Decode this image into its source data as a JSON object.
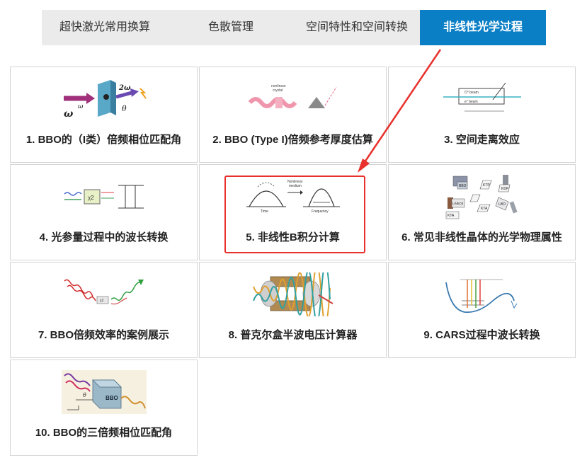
{
  "tabs": [
    {
      "label": "超快激光常用换算"
    },
    {
      "label": "色散管理"
    },
    {
      "label": "空间特性和空间转换"
    },
    {
      "label": "非线性光学过程",
      "active": true
    }
  ],
  "colors": {
    "accent": "#0b7fc6",
    "highlight": "#e8302c",
    "tab_bg": "#ebebeb"
  },
  "cards": [
    {
      "label": "1. BBO的（I类）倍频相位匹配角",
      "icon": "bbo-shg-crystal-icon",
      "art_text": [
        "ω",
        "ω",
        "2ω",
        "θ"
      ]
    },
    {
      "label": "2. BBO (Type I)倍频参考厚度估算",
      "icon": "pulse-through-crystal-icon",
      "art_text": [
        "nonlinear",
        "crystal"
      ]
    },
    {
      "label": "3. 空间走离效应",
      "icon": "walk-off-icon",
      "art_text": [
        "O° beam",
        "e° beam"
      ]
    },
    {
      "label": "4. 光参量过程中的波长转换",
      "icon": "parametric-process-icon",
      "art_text": [
        "χ2"
      ]
    },
    {
      "label": "5. 非线性B积分计算",
      "icon": "b-integral-icon",
      "art_text": [
        "Nonlinear",
        "medium",
        "Time",
        "Frequency"
      ]
    },
    {
      "label": "6. 常见非线性晶体的光学物理属性",
      "icon": "crystals-icon",
      "art_text": [
        "BBO",
        "KTP",
        "KDP",
        "LiNbO3",
        "KTA",
        "LBO",
        "KTA"
      ]
    },
    {
      "label": "7. BBO倍频效率的案例展示",
      "icon": "shg-efficiency-icon",
      "art_text": [
        "χ2"
      ]
    },
    {
      "label": "8. 普克尔盒半波电压计算器",
      "icon": "pockels-cell-icon",
      "art_text": []
    },
    {
      "label": "9. CARS过程中波长转换",
      "icon": "cars-potential-icon",
      "art_text": []
    },
    {
      "label": "10. BBO的三倍频相位匹配角",
      "icon": "bbo-thg-crystal-icon",
      "art_text": [
        "BBO",
        "θ"
      ]
    }
  ]
}
